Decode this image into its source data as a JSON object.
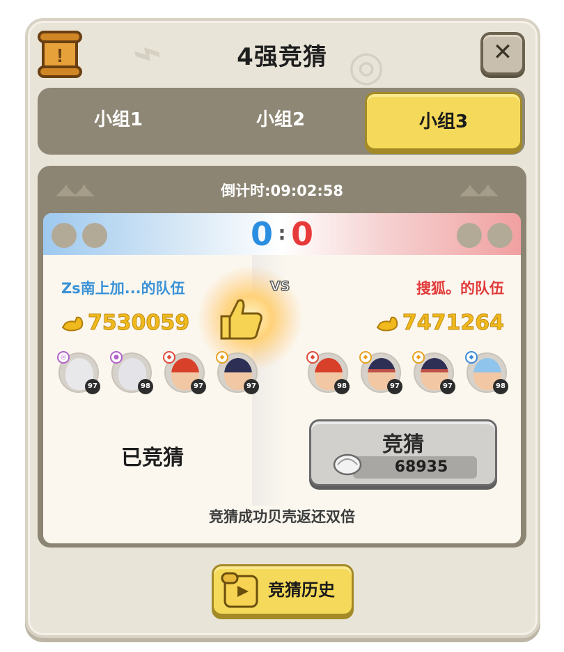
{
  "window": {
    "title": "4强竞猜",
    "close_label": "✕"
  },
  "tabs": [
    {
      "label": "小组1",
      "selected": false
    },
    {
      "label": "小组2",
      "selected": false
    },
    {
      "label": "小组3",
      "selected": true
    }
  ],
  "match": {
    "countdown_label": "倒计时:",
    "countdown_time": "09:02:58",
    "score_left": "0",
    "score_sep": ":",
    "score_right": "0",
    "vs_label": "VS",
    "left_team": {
      "name": "Zs南上加...的队伍",
      "power": "7530059",
      "heroes": [
        {
          "level": "97",
          "portrait": "white-hair-hero"
        },
        {
          "level": "98",
          "portrait": "white-hair-hero"
        },
        {
          "level": "97",
          "portrait": "red-hair-hero"
        },
        {
          "level": "97",
          "portrait": "dark-hair-hero"
        }
      ]
    },
    "right_team": {
      "name": "搜狐。的队伍",
      "power": "7471264",
      "heroes": [
        {
          "level": "98",
          "portrait": "red-hair-hero"
        },
        {
          "level": "97",
          "portrait": "headband-hero"
        },
        {
          "level": "97",
          "portrait": "headband-hero"
        },
        {
          "level": "98",
          "portrait": "blue-hair-hero"
        }
      ]
    },
    "guessed_label": "已竞猜",
    "guess_button": {
      "label": "竞猜",
      "cost": "68935",
      "currency_icon": "shell-icon"
    },
    "note": "竞猜成功贝壳返还双倍"
  },
  "history_button": {
    "label": "竞猜历史",
    "icon": "play-scroll-icon"
  },
  "colors": {
    "left_team": "#3a92d6",
    "right_team": "#e23b3b",
    "power": "#f0b91d",
    "active_tab": "#f5d95a"
  }
}
